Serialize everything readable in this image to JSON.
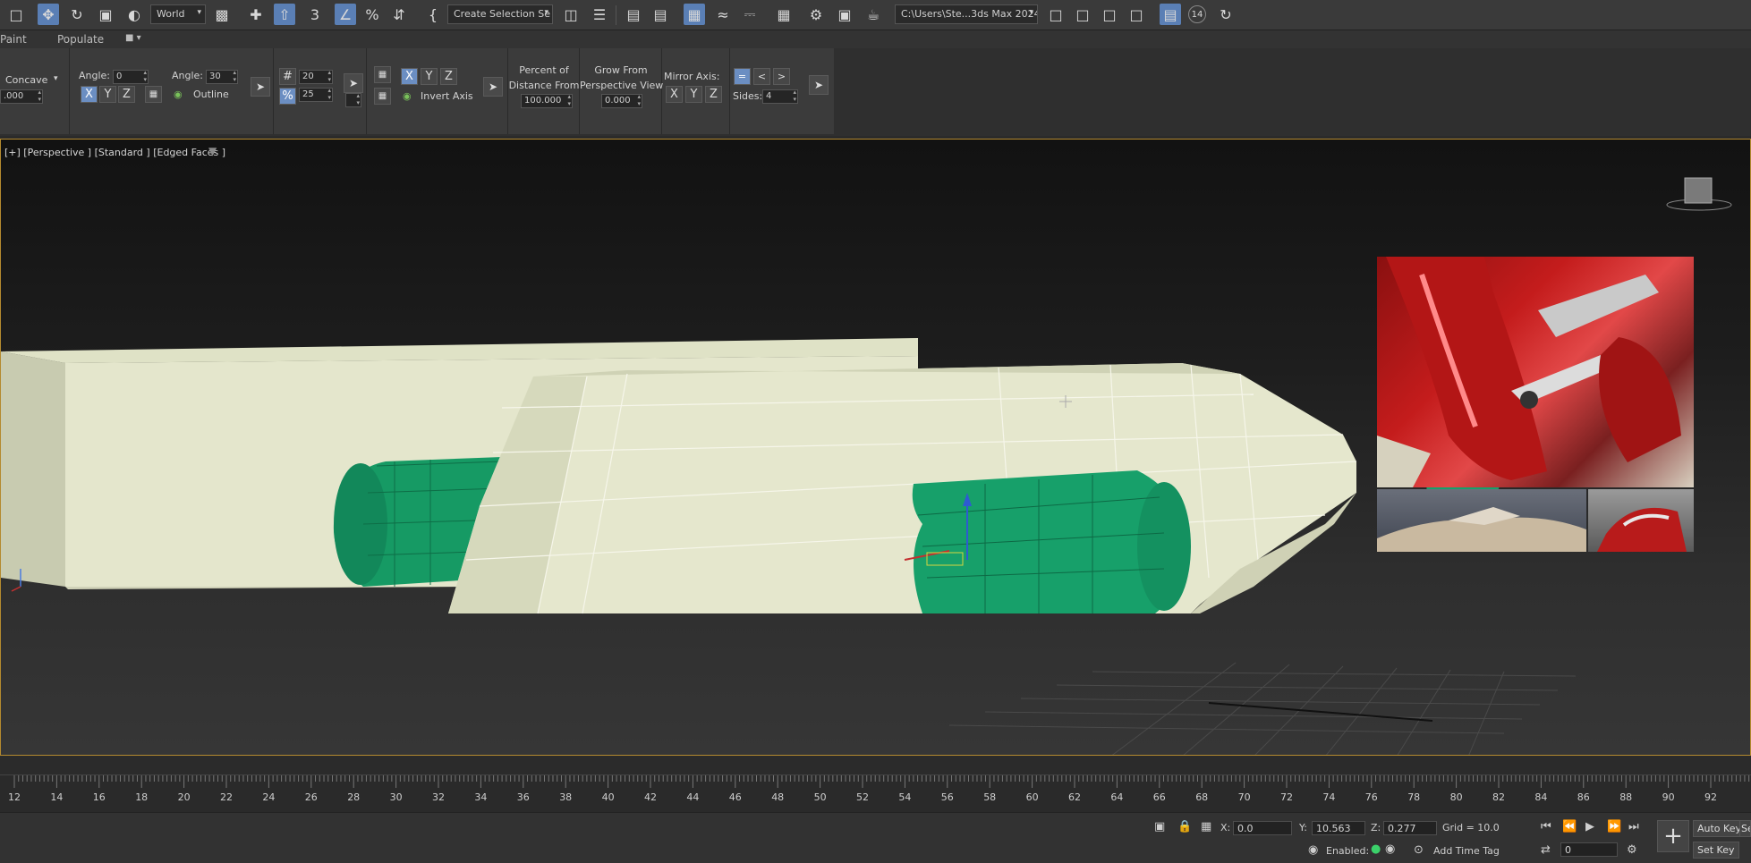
{
  "toolbar": {
    "reference_coord": "World",
    "named_selection": "Create Selection Se",
    "project_path": "C:\\Users\\Ste...3ds Max 2024",
    "badge_count": "14",
    "accent_color": "#5a7fb5"
  },
  "ribbon_tabs": [
    "Paint",
    "Populate"
  ],
  "ribbon": {
    "concave_label": "Concave",
    "concave_value": ".000",
    "angle1_label": "Angle:",
    "angle1_value": "0",
    "angle2_label": "Angle:",
    "angle2_value": "30",
    "outline_label": "Outline",
    "hash_value": "20",
    "percent_value": "25",
    "axis_x": "X",
    "axis_y": "Y",
    "axis_z": "Z",
    "invert_axis_label": "Invert Axis",
    "percent_of_label_1": "Percent of",
    "percent_of_label_2": "Distance From",
    "percent_value_field": "100.000",
    "grow_from_label_1": "Grow From",
    "grow_from_label_2": "Perspective View",
    "grow_value": "0.000",
    "mirror_axis_label": "Mirror Axis:",
    "sides_label": "Sides:",
    "sides_value": "4"
  },
  "viewport": {
    "label": "[+] [Perspective ] [Standard ] [Edged Faces ]",
    "border_color": "#b48a2f",
    "object_color_box": "#e7e8cf",
    "object_color_green": "#17a06a"
  },
  "timeline": {
    "ticks": [
      "12",
      "14",
      "16",
      "18",
      "20",
      "22",
      "24",
      "26",
      "28",
      "30",
      "32",
      "34",
      "36",
      "38",
      "40",
      "42",
      "44",
      "46",
      "48",
      "50",
      "52",
      "54",
      "56",
      "58",
      "60",
      "62",
      "64",
      "66",
      "68",
      "70",
      "72",
      "74",
      "76",
      "78",
      "80",
      "82",
      "84",
      "86",
      "88",
      "90",
      "92"
    ]
  },
  "status": {
    "x_label": "X:",
    "x_value": "0.0",
    "y_label": "Y:",
    "y_value": "10.563",
    "z_label": "Z:",
    "z_value": "0.277",
    "grid_label": "Grid = 10.0",
    "enabled_label": "Enabled:",
    "add_time_tag": "Add Time Tag",
    "auto_key": "Auto Key",
    "set_key": "Set Key",
    "frame_value": "0",
    "se_label": "Se"
  }
}
